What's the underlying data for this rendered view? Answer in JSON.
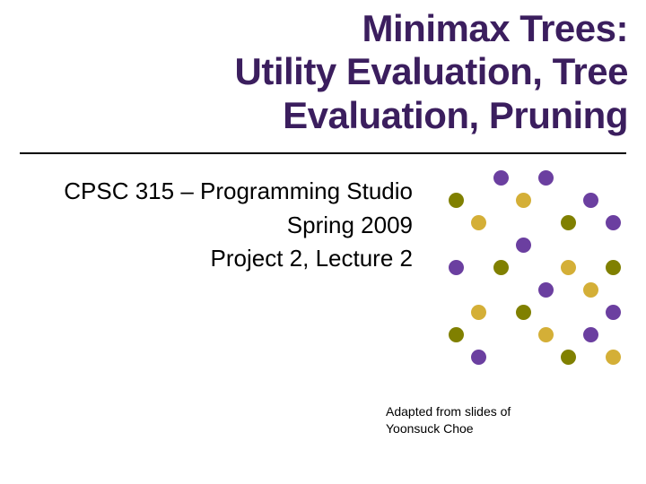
{
  "title": {
    "line1": "Minimax Trees:",
    "line2": "Utility Evaluation, Tree",
    "line3": "Evaluation, Pruning"
  },
  "subtitle": {
    "line1": "CPSC 315 – Programming Studio",
    "line2": "Spring 2009",
    "line3": "Project 2, Lecture 2"
  },
  "credit": {
    "line1": "Adapted from slides of",
    "line2": "Yoonsuck Choe"
  },
  "dots": {
    "rows": [
      [
        "",
        "",
        "purple",
        "",
        "purple",
        "",
        "",
        ""
      ],
      [
        "olive",
        "",
        "",
        "gold",
        "",
        "",
        "purple",
        ""
      ],
      [
        "",
        "gold",
        "",
        "",
        "",
        "olive",
        "",
        "purple"
      ],
      [
        "",
        "",
        "",
        "purple",
        "",
        "",
        "",
        ""
      ],
      [
        "purple",
        "",
        "olive",
        "",
        "",
        "gold",
        "",
        "olive"
      ],
      [
        "",
        "",
        "",
        "",
        "purple",
        "",
        "gold",
        ""
      ],
      [
        "",
        "gold",
        "",
        "olive",
        "",
        "",
        "",
        "purple"
      ],
      [
        "olive",
        "",
        "",
        "",
        "gold",
        "",
        "purple",
        ""
      ],
      [
        "",
        "purple",
        "",
        "",
        "",
        "olive",
        "",
        "gold"
      ]
    ]
  }
}
